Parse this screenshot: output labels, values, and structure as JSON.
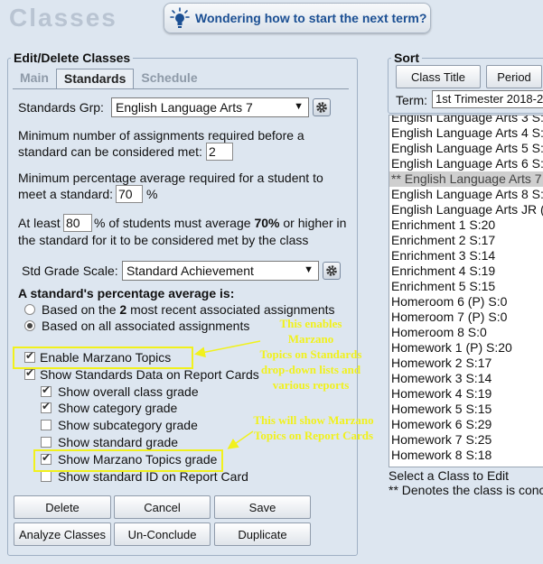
{
  "page": {
    "title": "Classes"
  },
  "hint": {
    "text": "Wondering how to start the next term?"
  },
  "edit": {
    "legend": "Edit/Delete Classes",
    "tabs": [
      "Main",
      "Standards",
      "Schedule"
    ],
    "standards_grp_label": "Standards Grp:",
    "standards_grp_value": "English Language Arts 7",
    "min_assign_line1": "Minimum number of assignments required before a",
    "min_assign_line2": "standard can be considered met:",
    "min_assign_value": "2",
    "min_pct_line1": "Minimum percentage average required for a student to",
    "min_pct_line2": "meet a standard:",
    "min_pct_value": "70",
    "pct_sign": "%",
    "atleast_a": "At least",
    "atleast_value": "80",
    "atleast_b": "% of students must average",
    "atleast_bold": "70%",
    "atleast_c": "or higher in",
    "atleast_line2": "the standard for it to be considered met by the class",
    "scale_label": "Std Grade Scale:",
    "scale_value": "Standard Achievement",
    "avg_heading": "A standard's percentage average is:",
    "radio1_a": "Based on the",
    "radio1_bold": "2",
    "radio1_b": "most recent associated assignments",
    "radio2": "Based on all associated assignments",
    "checkboxes": [
      {
        "label": "Enable Marzano Topics",
        "checked": true
      },
      {
        "label": "Show Standards Data on Report Cards",
        "checked": true
      },
      {
        "label": "Show overall class grade",
        "checked": true
      },
      {
        "label": "Show category grade",
        "checked": true
      },
      {
        "label": "Show subcategory grade",
        "checked": false
      },
      {
        "label": "Show standard grade",
        "checked": false
      },
      {
        "label": "Show Marzano Topics grade",
        "checked": true
      },
      {
        "label": "Show standard ID on Report Card",
        "checked": false
      }
    ],
    "buttons": [
      "Delete",
      "Cancel",
      "Save",
      "Analyze Classes",
      "Un-Conclude",
      "Duplicate"
    ]
  },
  "annotations": {
    "note1": [
      "This enables Marzano",
      "Topics on Standards",
      "drop-down lists and",
      "various reports"
    ],
    "note2": [
      "This will show Marzano",
      "Topics on Report Cards"
    ],
    "color": "#f1f11c"
  },
  "sort": {
    "legend": "Sort",
    "btn_title": "Class Title",
    "btn_period": "Period",
    "term_label": "Term:",
    "term_value": "1st Trimester 2018-2",
    "classes": [
      "English Language Arts 3   S:",
      "English Language Arts 4   S:",
      "English Language Arts 5   S:",
      "English Language Arts 6   S:",
      "** English Language Arts 7",
      "English Language Arts 8   S:",
      "English Language Arts JR  (P",
      "Enrichment 1   S:20",
      "Enrichment 2   S:17",
      "Enrichment 3   S:14",
      "Enrichment 4   S:19",
      "Enrichment 5   S:15",
      "Homeroom 6  (P)  S:0",
      "Homeroom 7  (P)  S:0",
      "Homeroom 8   S:0",
      "Homework 1  (P)  S:20",
      "Homework 2   S:17",
      "Homework 3   S:14",
      "Homework 4   S:19",
      "Homework 5   S:15",
      "Homework 6   S:29",
      "Homework 7   S:25",
      "Homework 8   S:18"
    ],
    "selected_index": 4,
    "footer1": "Select a Class to Edit",
    "footer2": "** Denotes the class is conc"
  }
}
